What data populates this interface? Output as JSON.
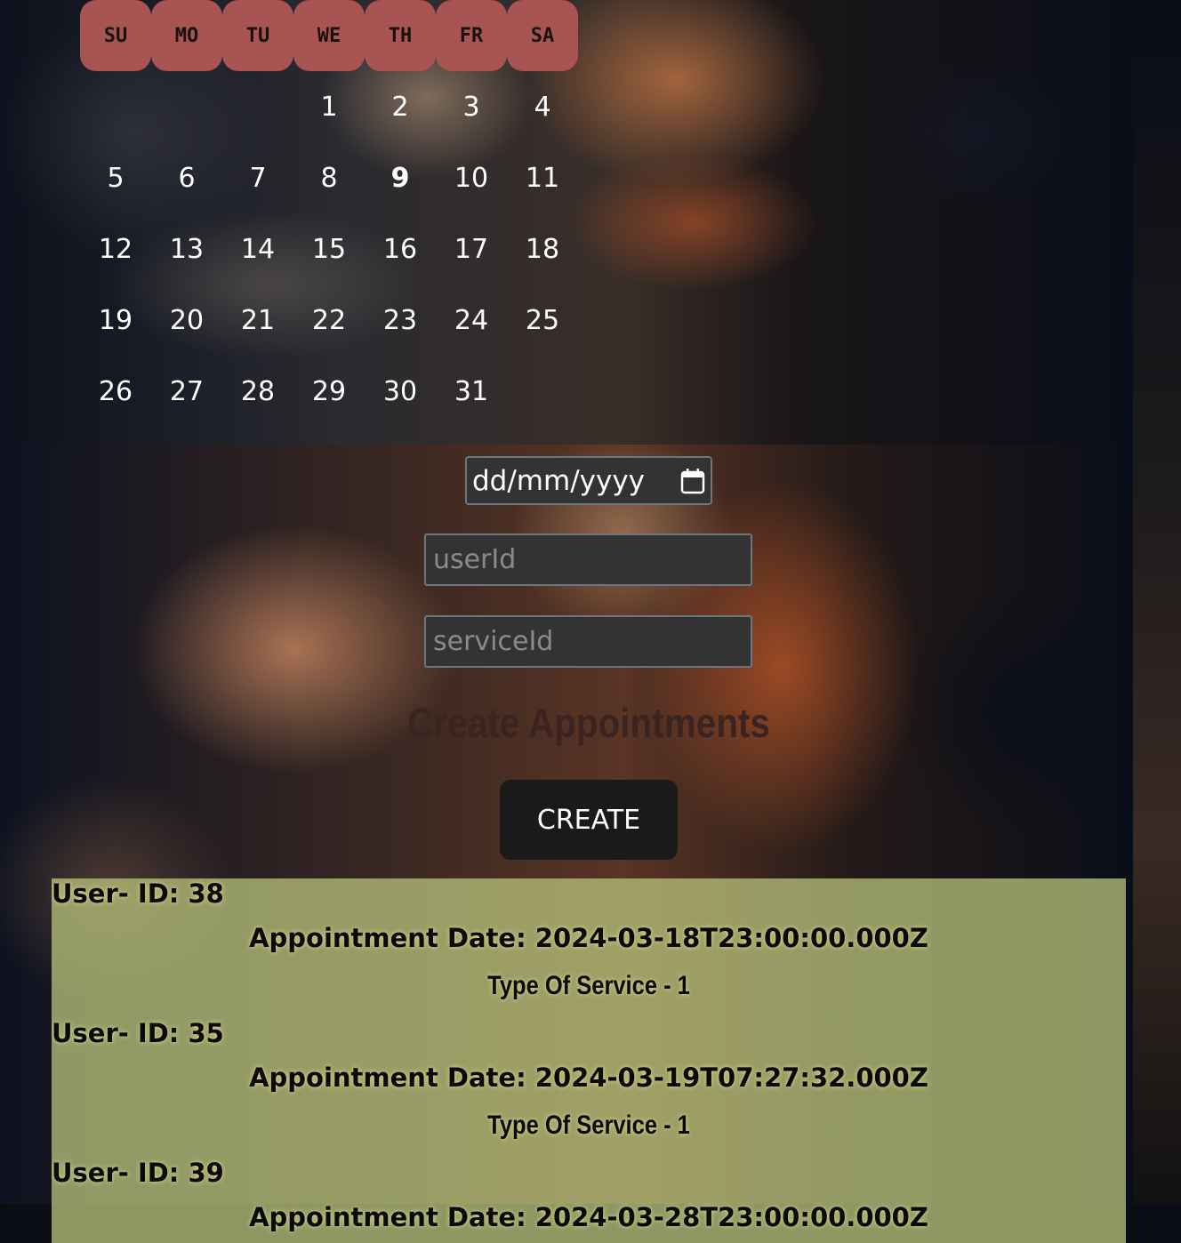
{
  "calendar": {
    "weekdays": [
      "SU",
      "MO",
      "TU",
      "WE",
      "TH",
      "FR",
      "SA"
    ],
    "leading_blanks": 3,
    "days": [
      "1",
      "2",
      "3",
      "4",
      "5",
      "6",
      "7",
      "8",
      "9",
      "10",
      "11",
      "12",
      "13",
      "14",
      "15",
      "16",
      "17",
      "18",
      "19",
      "20",
      "21",
      "22",
      "23",
      "24",
      "25",
      "26",
      "27",
      "28",
      "29",
      "30",
      "31"
    ],
    "highlighted_day": "9"
  },
  "form": {
    "date_value": "dd/mm/yyyy",
    "user_placeholder": "userId",
    "service_placeholder": "serviceId",
    "title": "Create Appointments",
    "create_label": "CREATE"
  },
  "appointments": [
    {
      "user": "User- ID: 38",
      "date": "Appointment Date: 2024-03-18T23:00:00.000Z",
      "service": "Type Of Service - 1"
    },
    {
      "user": "User- ID: 35",
      "date": "Appointment Date: 2024-03-19T07:27:32.000Z",
      "service": "Type Of Service - 1"
    },
    {
      "user": "User- ID: 39",
      "date": "Appointment Date: 2024-03-28T23:00:00.000Z",
      "service": ""
    }
  ]
}
